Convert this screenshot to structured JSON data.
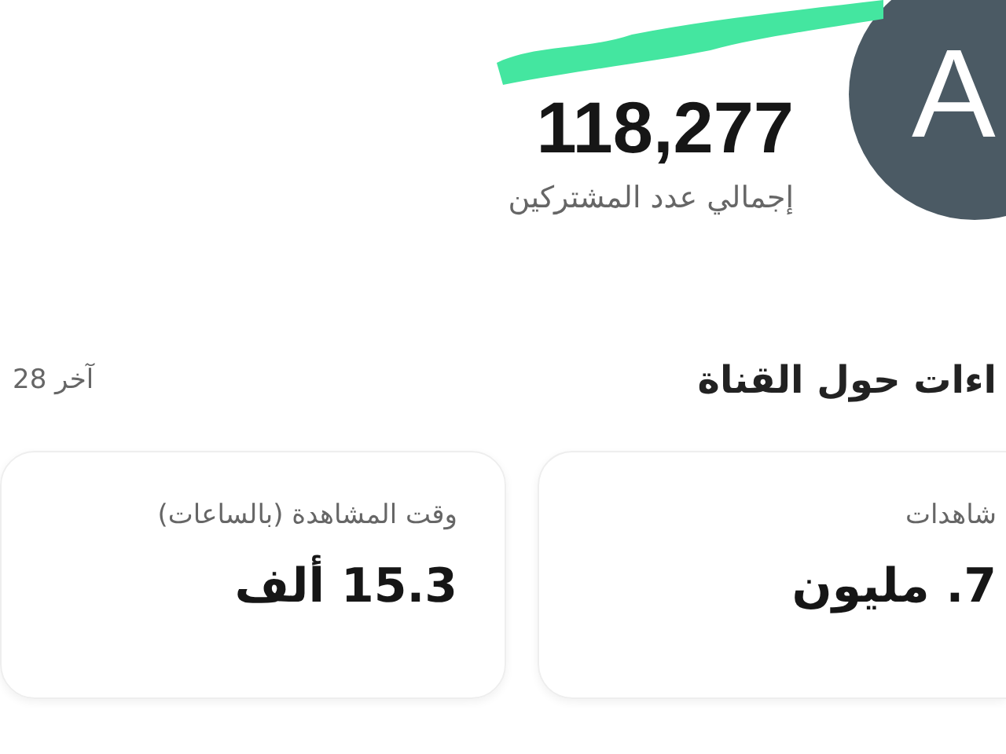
{
  "channel": {
    "avatar_letter": "A",
    "subscriber_count": "118,277",
    "subscriber_label": "إجمالي عدد المشتركين"
  },
  "insights": {
    "title": "اءات حول القناة",
    "period": "آخر 28"
  },
  "cards": [
    {
      "label": "شاهدات",
      "value": "7. مليون"
    },
    {
      "label": "وقت المشاهدة (بالساعات)",
      "value": "15.3 ألف"
    }
  ]
}
